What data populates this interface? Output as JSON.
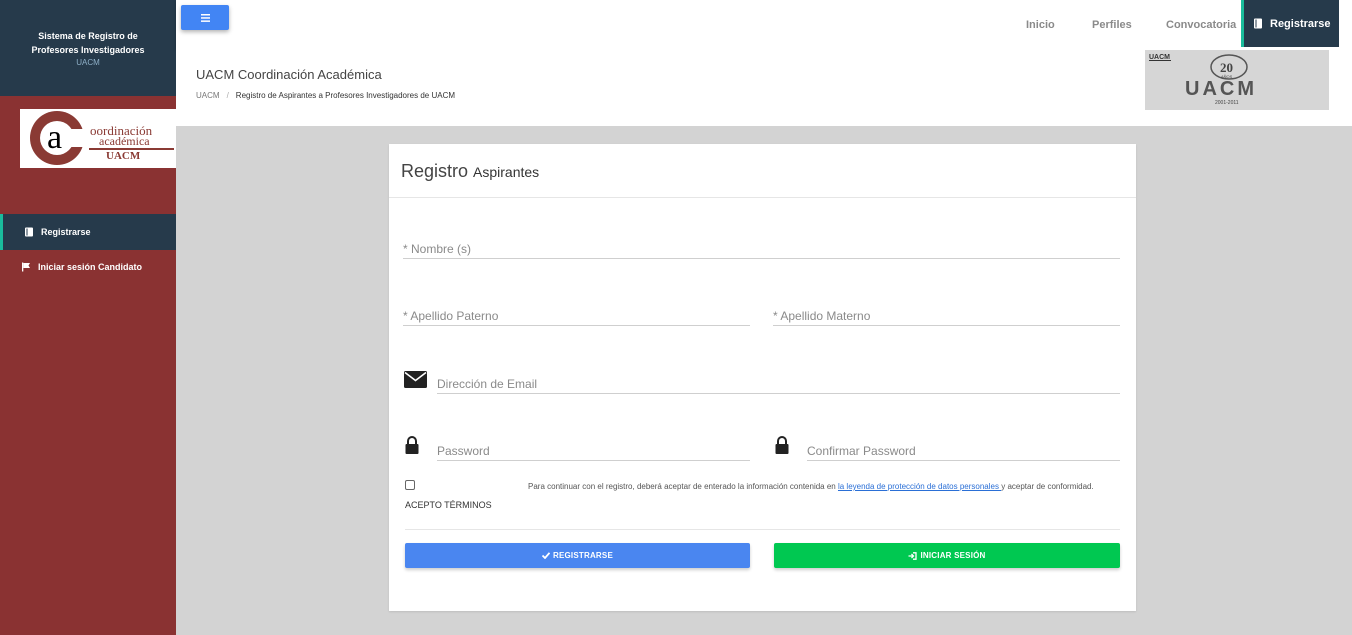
{
  "sidebar": {
    "title": "Sistema de Registro de Profesores Investigadores",
    "subtitle": "UACM",
    "logo": {
      "line1": "oordinación",
      "line2": "académica",
      "line3": "UACM",
      "letter": "a"
    },
    "items": [
      {
        "label": "Registrarse",
        "icon": "book-icon",
        "active": true
      },
      {
        "label": "Iniciar sesión Candidato",
        "icon": "flag-icon",
        "active": false
      }
    ]
  },
  "topbar": {
    "menu_icon": "hamburger-icon",
    "nav": [
      {
        "label": "Inicio"
      },
      {
        "label": "Perfiles"
      },
      {
        "label": "Convocatoria"
      },
      {
        "label": "Registrarse",
        "icon": "book-icon",
        "active": true
      }
    ]
  },
  "header": {
    "title": "UACM Coordinación Académica",
    "breadcrumb": {
      "home": "UACM",
      "separator": "/",
      "current": "Registro de Aspirantes a Profesores Investigadores de UACM"
    },
    "badge": {
      "number": "20",
      "small": "AÑOS",
      "brand": "UACM",
      "years": "2001-2011",
      "top": "UACM"
    }
  },
  "form": {
    "title_main": "Registro",
    "title_sub": "Aspirantes",
    "nombre": {
      "placeholder": "* Nombre (s)",
      "value": ""
    },
    "apellido_paterno": {
      "placeholder": "* Apellido Paterno",
      "value": ""
    },
    "apellido_materno": {
      "placeholder": "* Apellido Materno",
      "value": ""
    },
    "email": {
      "placeholder": "Dirección de Email",
      "value": "",
      "icon": "envelope-icon"
    },
    "password": {
      "placeholder": "Password",
      "value": "",
      "icon": "lock-icon"
    },
    "confirm_password": {
      "placeholder": "Confirmar Password",
      "value": "",
      "icon": "lock-icon"
    },
    "terms": {
      "checked": false,
      "label": "ACEPTO TÉRMINOS",
      "text_before": "Para continuar con el registro, deberá aceptar de enterado la información contenida en ",
      "link": "la leyenda de protección de datos personales ",
      "text_after": "y aceptar de conformidad."
    },
    "buttons": {
      "register": "REGISTRARSE",
      "register_icon": "check-icon",
      "login": "INICIAR SESIÓN",
      "login_icon": "sign-in-icon"
    }
  },
  "colors": {
    "sidebar_bg": "#8a3232",
    "sidebar_header": "#263a4b",
    "accent_teal": "#1abc9c",
    "primary_blue": "#4a86f0",
    "success_green": "#00c851",
    "page_bg": "#d3d3d3"
  }
}
